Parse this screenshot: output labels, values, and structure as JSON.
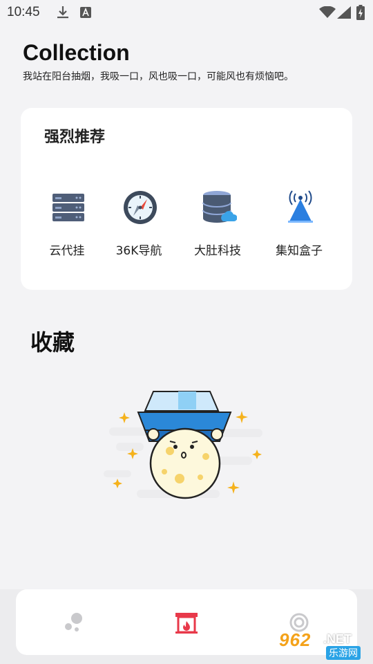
{
  "status_bar": {
    "time": "10:45",
    "icons": [
      "download-icon",
      "font-a-icon",
      "wifi-icon",
      "signal-icon",
      "battery-charging-icon"
    ]
  },
  "header": {
    "title": "Collection",
    "subtitle": "我站在阳台抽烟，我吸一口，风也吸一口，可能风也有烦恼吧。"
  },
  "recommend": {
    "title": "强烈推荐",
    "items": [
      {
        "label": "云代挂",
        "icon": "server-icon"
      },
      {
        "label": "36K导航",
        "icon": "compass-icon"
      },
      {
        "label": "大肚科技",
        "icon": "database-cloud-icon"
      },
      {
        "label": "集知盒子",
        "icon": "antenna-icon"
      }
    ]
  },
  "favorites": {
    "title": "收藏",
    "empty_illustration": "moon-character-empty-icon"
  },
  "tab_bar": {
    "tabs": [
      {
        "icon": "bubbles-icon",
        "active": false
      },
      {
        "icon": "fireplace-icon",
        "active": true
      },
      {
        "icon": "rings-icon",
        "active": false
      }
    ],
    "active_color": "#e8394a"
  },
  "watermark": {
    "number": "962",
    "suffix": ".NET",
    "site": "乐游网"
  }
}
